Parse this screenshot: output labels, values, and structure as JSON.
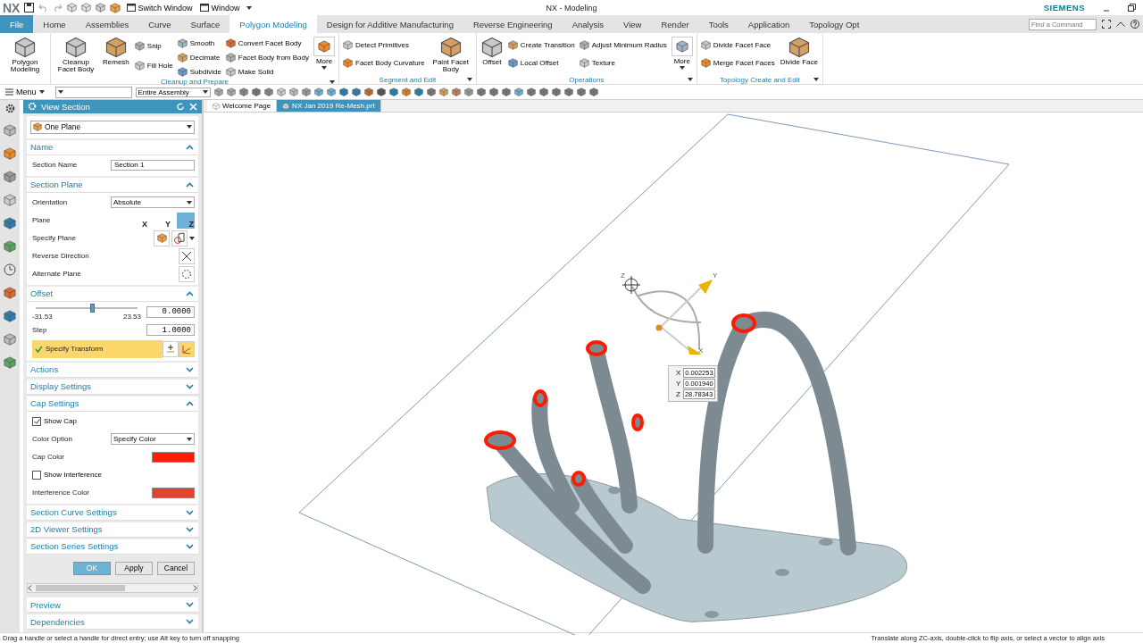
{
  "title_bar": {
    "logo": "NX",
    "quick_access": [
      "Switch Window",
      "Window"
    ],
    "title": "NX - Modeling",
    "brand": "SIEMENS"
  },
  "menu_tabs": [
    {
      "label": "File",
      "kind": "file",
      "selected": false
    },
    {
      "label": "Home",
      "kind": "tab",
      "selected": false
    },
    {
      "label": "Assemblies",
      "kind": "tab",
      "selected": false
    },
    {
      "label": "Curve",
      "kind": "tab",
      "selected": false
    },
    {
      "label": "Surface",
      "kind": "tab",
      "selected": false
    },
    {
      "label": "Polygon Modeling",
      "kind": "tab",
      "selected": true
    },
    {
      "label": "Design for Additive Manufacturing",
      "kind": "tab",
      "selected": false
    },
    {
      "label": "Reverse Engineering",
      "kind": "tab",
      "selected": false
    },
    {
      "label": "Analysis",
      "kind": "tab",
      "selected": false
    },
    {
      "label": "View",
      "kind": "tab",
      "selected": false
    },
    {
      "label": "Render",
      "kind": "tab",
      "selected": false
    },
    {
      "label": "Tools",
      "kind": "tab",
      "selected": false
    },
    {
      "label": "Application",
      "kind": "tab",
      "selected": false
    },
    {
      "label": "Topology Opt",
      "kind": "tab",
      "selected": false
    }
  ],
  "search": {
    "placeholder": "Find a Command"
  },
  "ribbon_groups": [
    {
      "columns": [
        [
          {
            "label": "Polygon Modeling",
            "kind": "large"
          }
        ]
      ]
    },
    {
      "title": "Cleanup and Prepare",
      "columns": [
        [
          {
            "label": "Cleanup Facet Body",
            "kind": "large"
          }
        ],
        [
          {
            "label": "Remesh",
            "kind": "large"
          }
        ],
        [
          {
            "label": "Snip",
            "kind": "small"
          },
          {
            "label": "Fill Hole",
            "kind": "small"
          }
        ],
        [
          {
            "label": "Smooth",
            "kind": "small"
          },
          {
            "label": "Decimate",
            "kind": "small"
          },
          {
            "label": "Subdivide",
            "kind": "small"
          }
        ],
        [
          {
            "label": "Convert Facet Body",
            "kind": "small"
          },
          {
            "label": "Facet Body from Body",
            "kind": "small"
          },
          {
            "label": "Make Solid",
            "kind": "small"
          }
        ],
        [
          {
            "label": "More",
            "kind": "more"
          }
        ]
      ]
    },
    {
      "title": "Segment and Edit",
      "columns": [
        [
          {
            "label": "Detect Primitives",
            "kind": "small"
          },
          {
            "label": "Facet Body Curvature",
            "kind": "small"
          }
        ],
        [
          {
            "label": "Paint Facet Body",
            "kind": "large"
          }
        ]
      ]
    },
    {
      "title": "Operations",
      "columns": [
        [
          {
            "label": "Offset",
            "kind": "large"
          }
        ],
        [
          {
            "label": "Create Transition",
            "kind": "small"
          },
          {
            "label": "Local Offset",
            "kind": "small"
          }
        ],
        [
          {
            "label": "Adjust Minimum Radius",
            "kind": "small"
          },
          {
            "label": "Texture",
            "kind": "small"
          }
        ],
        [
          {
            "label": "More",
            "kind": "more"
          }
        ]
      ]
    },
    {
      "title": "Topology Create and Edit",
      "columns": [
        [
          {
            "label": "Divide Facet Face",
            "kind": "small"
          },
          {
            "label": "Merge Facet Faces",
            "kind": "small"
          }
        ],
        [
          {
            "label": "Divide Face",
            "kind": "large"
          }
        ]
      ]
    }
  ],
  "toolbar": {
    "menu": "Menu",
    "scope": "Entire Assembly"
  },
  "doc_tabs": [
    {
      "label": "Welcome Page",
      "selected": false
    },
    {
      "label": "NX Jan 2019 Re-Mesh.prt",
      "selected": true
    }
  ],
  "dialog": {
    "title": "View Section",
    "type": "One Plane",
    "sections": [
      {
        "title": "Name",
        "expanded": true,
        "rows": [
          {
            "kind": "field",
            "label": "Section Name",
            "value": "Section 1"
          }
        ]
      },
      {
        "title": "Section Plane",
        "expanded": true,
        "rows": [
          {
            "kind": "dropdown",
            "label": "Orientation",
            "value": "Absolute"
          },
          {
            "kind": "axes",
            "label": "Plane",
            "options": [
              {
                "axis": "X",
                "selected": false
              },
              {
                "axis": "Y",
                "selected": false
              },
              {
                "axis": "Z",
                "selected": true
              }
            ]
          },
          {
            "kind": "plane",
            "label": "Specify Plane"
          },
          {
            "kind": "reverse",
            "label": "Reverse Direction"
          },
          {
            "kind": "alternate",
            "label": "Alternate Plane"
          }
        ]
      },
      {
        "title": "Offset",
        "expanded": true,
        "rows": [
          {
            "kind": "slider",
            "level": 0.56,
            "min": "-31.53",
            "max": "23.53",
            "value": "0.0000"
          },
          {
            "kind": "number",
            "label": "Step",
            "value": "1.0000"
          },
          {
            "kind": "transform",
            "label": "Specify Transform",
            "done": true
          }
        ]
      },
      {
        "title": "Actions",
        "expanded": false
      },
      {
        "title": "Display Settings",
        "expanded": false
      },
      {
        "title": "Cap Settings",
        "expanded": true,
        "rows": [
          {
            "kind": "checkbox",
            "label": "Show Cap",
            "checked": true
          },
          {
            "kind": "dropdown",
            "label": "Color Option",
            "value": "Specify Color"
          },
          {
            "kind": "color",
            "label": "Cap Color",
            "color": "#ff1a00"
          },
          {
            "kind": "checkbox",
            "label": "Show Interference",
            "checked": false
          },
          {
            "kind": "color",
            "label": "Interference Color",
            "color": "#e0442f"
          }
        ]
      },
      {
        "title": "Section Curve Settings",
        "expanded": false
      },
      {
        "title": "2D Viewer Settings",
        "expanded": false
      },
      {
        "title": "Section Series Settings",
        "expanded": false
      }
    ],
    "buttons": [
      {
        "label": "OK",
        "kind": "primary"
      },
      {
        "label": "Apply",
        "kind": "normal"
      },
      {
        "label": "Cancel",
        "kind": "normal"
      }
    ],
    "extra_sections": [
      {
        "title": "Preview",
        "expanded": false
      },
      {
        "title": "Dependencies",
        "expanded": false
      }
    ]
  },
  "viewport": {
    "axis_labels": [
      {
        "axis": "Z"
      },
      {
        "axis": "Y"
      },
      {
        "axis": "X"
      }
    ],
    "readout": [
      {
        "axis": "X",
        "value": "0.002253"
      },
      {
        "axis": "Y",
        "value": "0.001940"
      },
      {
        "axis": "Z",
        "value": "28.78343"
      }
    ]
  },
  "status_bar": {
    "left": "Drag a handle or select a handle for direct entry; use Alt key to turn off snapping",
    "right": "Translate along ZC-axis, double-click to flip axis, or select a vector to align axis"
  }
}
